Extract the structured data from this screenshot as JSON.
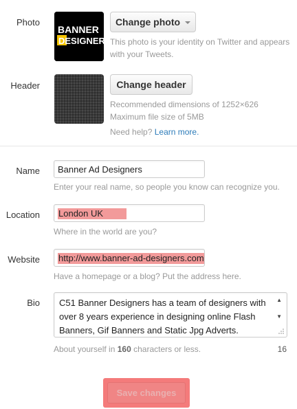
{
  "photo": {
    "label": "Photo",
    "logo_line1": "BANNER",
    "logo_line2": "DESIGNERS",
    "button_label": "Change photo",
    "help_line1": "This photo is your identity on Twitter and appears",
    "help_line2": "with your Tweets."
  },
  "header": {
    "label": "Header",
    "button_label": "Change header",
    "help_line1": "Recommended dimensions of 1252×626",
    "help_line2": "Maximum file size of 5MB",
    "need_help": "Need help?",
    "learn_more": "Learn more."
  },
  "name": {
    "label": "Name",
    "value": "Banner Ad Designers",
    "help": "Enter your real name, so people you know can recognize you."
  },
  "location": {
    "label": "Location",
    "value": "London UK",
    "help": "Where in the world are you?"
  },
  "website": {
    "label": "Website",
    "value": "http://www.banner-ad-designers.com",
    "help": "Have a homepage or a blog? Put the address here."
  },
  "bio": {
    "label": "Bio",
    "value_line1": "C51 Banner Designers has a team of designers with",
    "value_line2": "over 8 years experience in designing online Flash",
    "value_line3": "Banners, Gif Banners and Static Jpg Adverts.",
    "help_prefix": "About yourself in",
    "help_count": "160",
    "help_suffix": "characters or less.",
    "remaining": "16"
  },
  "save": {
    "label": "Save changes"
  },
  "colors": {
    "highlight": "#f29a9a",
    "link": "#2b7bb9",
    "save_outline": "#f47b7b",
    "logo_yellow": "#f5c400"
  }
}
